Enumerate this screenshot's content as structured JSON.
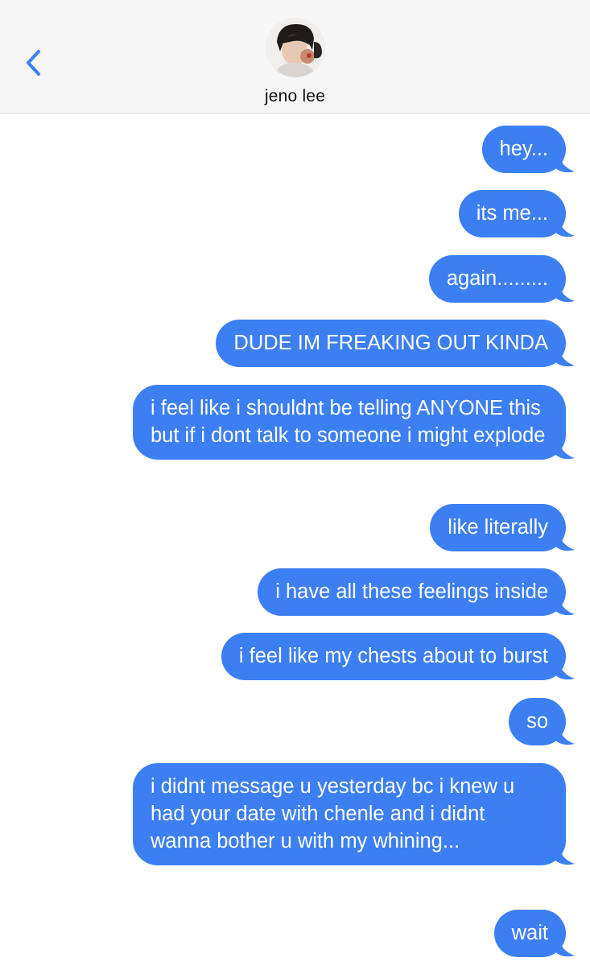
{
  "header": {
    "contact_name": "jeno lee",
    "back_icon": "chevron-left-icon"
  },
  "colors": {
    "bubble_blue": "#3b7ff3",
    "header_bg": "#f6f6f6",
    "accent": "#3b7ff3"
  },
  "messages": [
    {
      "text": "hey...",
      "sender": "me"
    },
    {
      "text": "its me...",
      "sender": "me"
    },
    {
      "text": "again.........",
      "sender": "me"
    },
    {
      "text": "DUDE IM FREAKING OUT KINDA",
      "sender": "me"
    },
    {
      "text": "i feel like i shouldnt be telling ANYONE this but if i dont talk to someone i might explode",
      "sender": "me"
    },
    {
      "text": "like literally",
      "sender": "me"
    },
    {
      "text": "i have all these feelings inside",
      "sender": "me"
    },
    {
      "text": "i feel like my chests about to burst",
      "sender": "me"
    },
    {
      "text": "so",
      "sender": "me"
    },
    {
      "text": "i didnt message u yesterday bc i knew u had your date with chenle and i didnt wanna bother u with my whining...",
      "sender": "me"
    },
    {
      "text": "wait",
      "sender": "me"
    }
  ]
}
